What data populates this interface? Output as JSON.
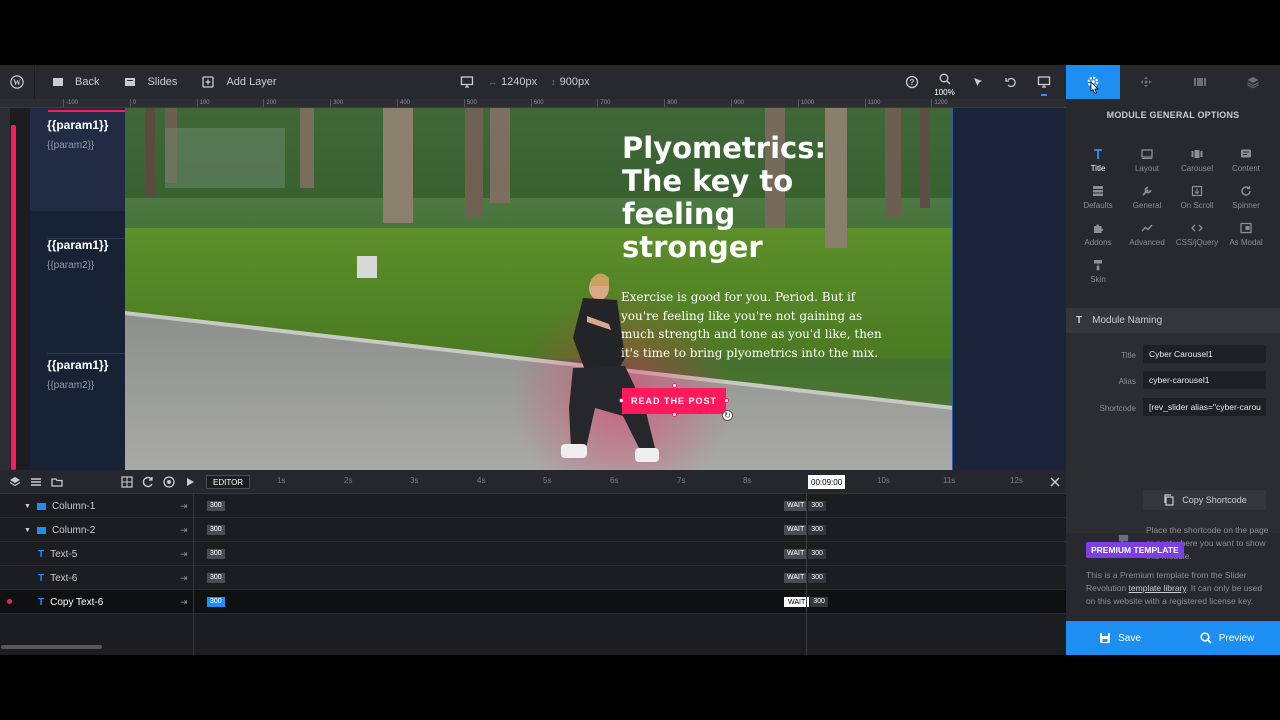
{
  "toolbar": {
    "back_label": "Back",
    "slides_label": "Slides",
    "add_layer_label": "Add Layer",
    "width_value": "1240px",
    "height_value": "900px",
    "zoom_level": "100%"
  },
  "ruler": {
    "ticks": [
      "-100",
      "0",
      "100",
      "200",
      "300",
      "400",
      "500",
      "600",
      "700",
      "800",
      "900",
      "1000",
      "1100",
      "1200"
    ]
  },
  "slide_thumbs": [
    {
      "title": "{{param1}}",
      "sub": "{{param2}}"
    },
    {
      "title": "{{param1}}",
      "sub": "{{param2}}"
    },
    {
      "title": "{{param1}}",
      "sub": "{{param2}}"
    }
  ],
  "slide": {
    "headline": "Plyometrics: The key to feeling stronger",
    "body": "Exercise is good for you. Period. But if you're feeling like you're not gaining as much strength and tone as you'd like, then it's time to bring plyometrics into the mix.",
    "button_label": "READ THE POST"
  },
  "timeline": {
    "editor_label": "EDITOR",
    "seconds": [
      "1s",
      "2s",
      "3s",
      "4s",
      "5s",
      "6s",
      "7s",
      "8s",
      "10s",
      "11s",
      "12s"
    ],
    "current_time": "00:09:00",
    "rows": [
      {
        "name": "Column-1",
        "type": "column",
        "duration": "300",
        "wait": "WAIT",
        "end": "300"
      },
      {
        "name": "Column-2",
        "type": "column",
        "duration": "300",
        "wait": "WAIT",
        "end": "300"
      },
      {
        "name": "Text-5",
        "type": "text",
        "duration": "300",
        "wait": "WAIT",
        "end": "300"
      },
      {
        "name": "Text-6",
        "type": "text",
        "duration": "300",
        "wait": "WAIT",
        "end": "300"
      },
      {
        "name": "Copy Text-6",
        "type": "text",
        "duration": "300",
        "wait": "WAIT",
        "end": "300",
        "selected": true
      }
    ]
  },
  "panel": {
    "title": "MODULE GENERAL OPTIONS",
    "options": [
      "Title",
      "Layout",
      "Carousel",
      "Content",
      "Defaults",
      "General",
      "On Scroll",
      "Spinner",
      "Addons",
      "Advanced",
      "CSS/jQuery",
      "As Modal",
      "Skin"
    ],
    "naming_header": "Module Naming",
    "title_label": "Title",
    "title_value": "Cyber Carousel1",
    "alias_label": "Alias",
    "alias_value": "cyber-carousel1",
    "shortcode_label": "Shortcode",
    "shortcode_value": "[rev_slider alias=\"cyber-carou",
    "copy_shortcode": "Copy Shortcode",
    "hint": "Place the shortcode on the page or post where you want to show this module.",
    "premium_badge": "PREMIUM TEMPLATE",
    "premium_text_1": "This is a Premium template from the Slider Revolution",
    "premium_link": "template library",
    "premium_text_2": ". It can only be used on this website with a registered license key.",
    "save_label": "Save",
    "preview_label": "Preview"
  },
  "colors": {
    "accent": "#1d8ff3",
    "pink": "#ff1a5e",
    "premium": "#7b3fe4"
  }
}
